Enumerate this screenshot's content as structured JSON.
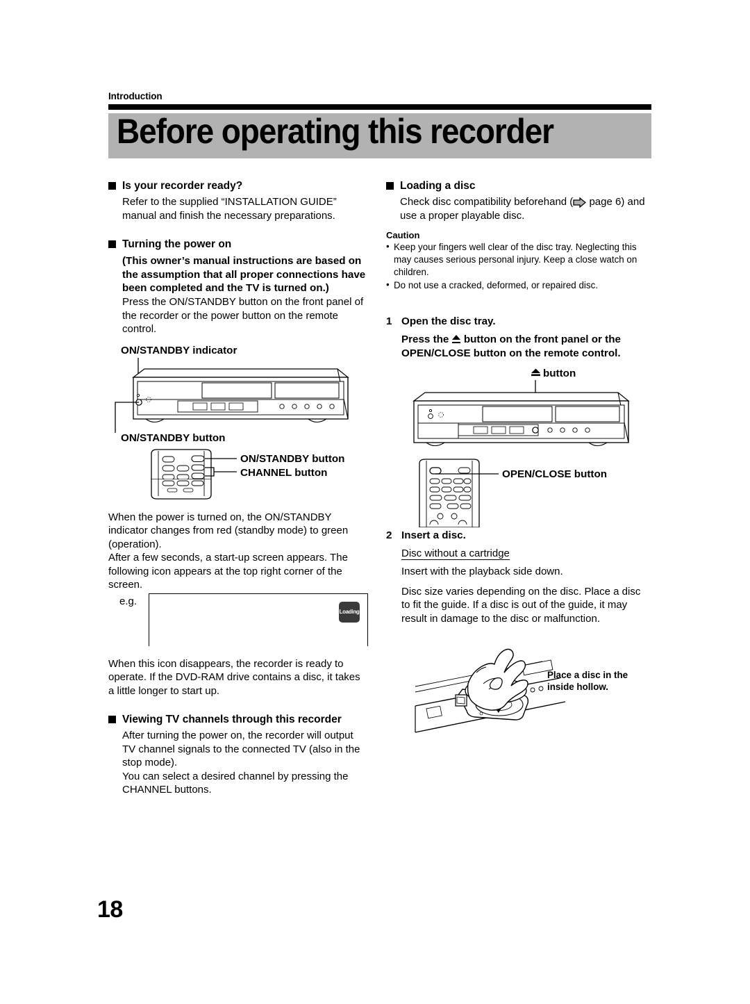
{
  "page": {
    "section_label": "Introduction",
    "title": "Before operating this recorder",
    "page_number": "18",
    "accent_gray": "#b2b2b2",
    "rule_color": "#000000"
  },
  "left_column": {
    "section_ready": {
      "heading": "Is your recorder ready?",
      "body": "Refer to the supplied “INSTALLATION GUIDE” manual and finish the necessary preparations."
    },
    "section_power": {
      "heading": "Turning the power on",
      "bold_note": "(This owner’s manual instructions are based on the assumption that all proper connections have been completed and the TV is turned on.)",
      "body": "Press the ON/STANDBY button on the front panel of the recorder or the power button on the remote control."
    },
    "figure_front_panel": {
      "callout_top": "ON/STANDBY indicator",
      "callout_bottom": "ON/STANDBY button"
    },
    "figure_remote": {
      "callout_1": "ON/STANDBY button",
      "callout_2": "CHANNEL button"
    },
    "power_result": {
      "para1": "When the power is turned on, the ON/STANDBY indicator changes from red (standby mode) to green (operation).",
      "para2": "After a few seconds, a start-up screen appears. The following icon appears at the top right corner of the screen."
    },
    "example_screen": {
      "label": "e.g.",
      "icon_label": "Loading"
    },
    "after_icon": "When this icon disappears, the recorder is ready to operate.  If the DVD-RAM drive contains a disc, it takes a little longer to start up.",
    "section_viewing": {
      "heading": "Viewing TV channels through this recorder",
      "para1": "After turning the power on, the recorder will output TV channel signals to the connected TV (also in the stop mode).",
      "para2": "You can select a desired channel by pressing the CHANNEL buttons."
    }
  },
  "right_column": {
    "section_loading": {
      "heading": "Loading a disc",
      "body_before": "Check disc compatibility beforehand (",
      "body_after": " page 6) and use a proper playable disc.",
      "arrow_icon": "page-reference-arrow-icon"
    },
    "caution": {
      "heading": "Caution",
      "items": [
        "Keep your fingers well clear of the disc tray. Neglecting this may causes serious personal injury.  Keep a close watch on children.",
        "Do not use a cracked, deformed, or repaired disc."
      ]
    },
    "step1": {
      "number": "1",
      "title": "Open the disc tray.",
      "detail_before": "Press the ",
      "detail_after": " button on the front panel or the OPEN/CLOSE button on the remote control.",
      "eject_icon": "eject-icon"
    },
    "figure_front_panel": {
      "callout_before": "",
      "callout_after": " button"
    },
    "figure_remote": {
      "callout": "OPEN/CLOSE button"
    },
    "step2": {
      "number": "2",
      "title": "Insert a disc.",
      "subtitle": "Disc without a cartridge",
      "para1": "Insert with the playback side down.",
      "para2": "Disc size varies depending on the disc. Place a disc to fit the guide. If a disc is out of the guide, it may result in damage to the disc or malfunction."
    },
    "figure_tray": {
      "callout_line1": "Place a disc in the",
      "callout_line2": "inside hollow."
    }
  }
}
